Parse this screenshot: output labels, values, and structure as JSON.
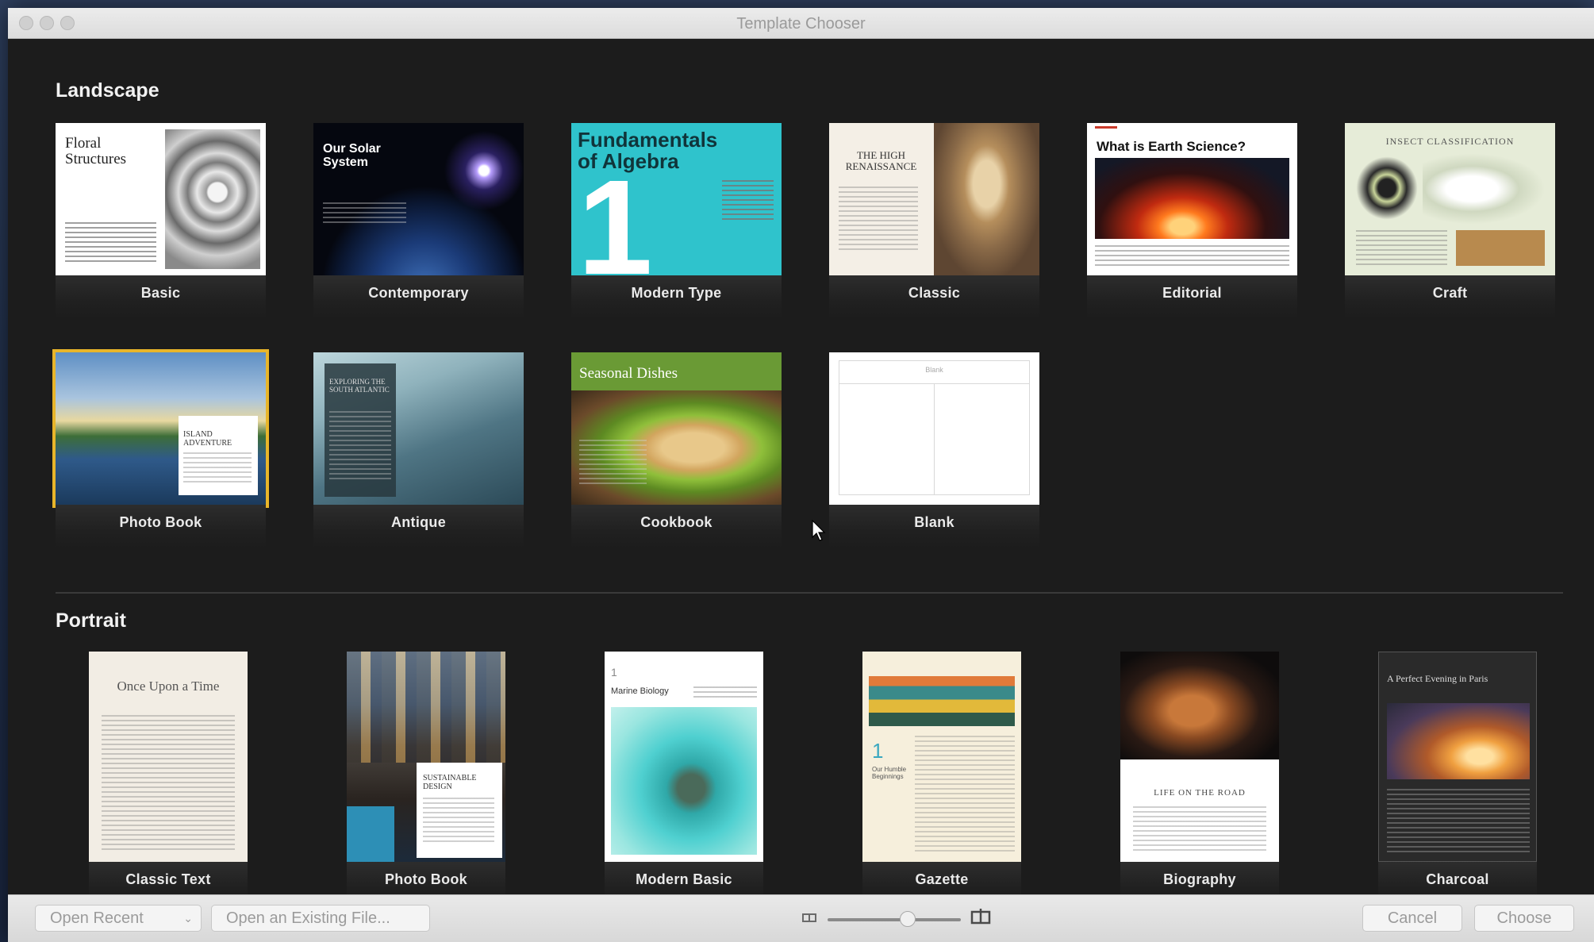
{
  "window": {
    "title": "Template Chooser"
  },
  "sections": {
    "landscape": "Landscape",
    "portrait": "Portrait"
  },
  "landscape": [
    {
      "label": "Basic",
      "title": "Floral Structures"
    },
    {
      "label": "Contemporary",
      "title": "Our Solar System"
    },
    {
      "label": "Modern Type",
      "title": "Fundamentals of Algebra",
      "number": "1"
    },
    {
      "label": "Classic",
      "title": "THE HIGH RENAISSANCE"
    },
    {
      "label": "Editorial",
      "title": "What is Earth Science?"
    },
    {
      "label": "Craft",
      "title": "INSECT CLASSIFICATION"
    },
    {
      "label": "Photo Book",
      "title": "ISLAND ADVENTURE"
    },
    {
      "label": "Antique",
      "title": "EXPLORING THE SOUTH ATLANTIC"
    },
    {
      "label": "Cookbook",
      "title": "Seasonal Dishes"
    },
    {
      "label": "Blank",
      "title": "Blank"
    }
  ],
  "portrait": [
    {
      "label": "Classic Text",
      "title": "Once Upon a Time"
    },
    {
      "label": "Photo Book",
      "title": "SUSTAINABLE DESIGN"
    },
    {
      "label": "Modern Basic",
      "title": "Marine Biology",
      "number": "1"
    },
    {
      "label": "Gazette",
      "title": "Our Humble Beginnings",
      "number": "1"
    },
    {
      "label": "Biography",
      "title": "LIFE ON THE ROAD"
    },
    {
      "label": "Charcoal",
      "title": "A Perfect Evening in Paris"
    }
  ],
  "bottom": {
    "open_recent": "Open Recent",
    "open_existing": "Open an Existing File...",
    "cancel": "Cancel",
    "choose": "Choose"
  },
  "zoom_level": 0.6,
  "colors": {
    "selection": "#e8b52a",
    "modern_type": "#2fc3cc",
    "cookbook": "#6a9a35"
  }
}
